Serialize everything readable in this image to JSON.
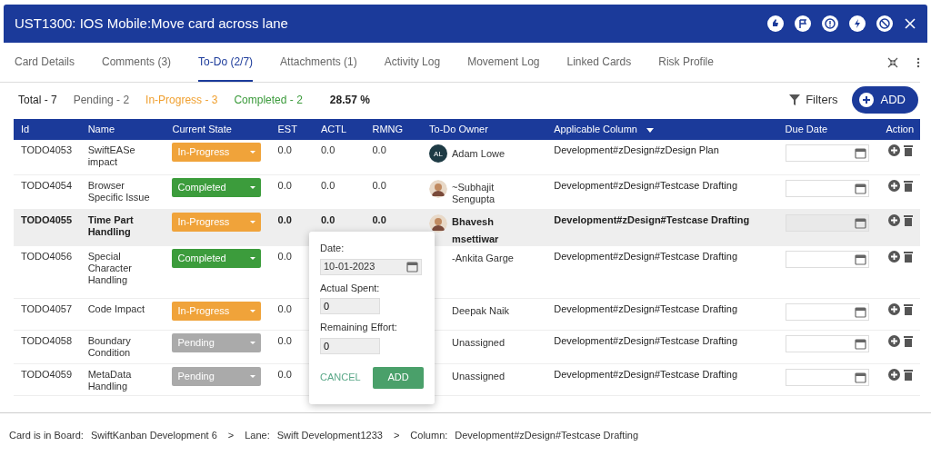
{
  "window": {
    "title": "UST1300:  IOS Mobile:Move card across lane"
  },
  "header_icons": [
    {
      "kind": "thumbs"
    },
    {
      "kind": "flag"
    },
    {
      "kind": "alert"
    },
    {
      "kind": "bolt"
    },
    {
      "kind": "block"
    }
  ],
  "tabs": [
    {
      "label": "Card Details",
      "selected": false
    },
    {
      "label": "Comments (3)",
      "selected": false
    },
    {
      "label": "To-Do (2/7)",
      "selected": true
    },
    {
      "label": "Attachments (1)",
      "selected": false
    },
    {
      "label": "Activity Log",
      "selected": false
    },
    {
      "label": "Movement Log",
      "selected": false
    },
    {
      "label": "Linked Cards",
      "selected": false
    },
    {
      "label": "Risk Profile",
      "selected": false
    }
  ],
  "summary": [
    {
      "text": "Total - 7",
      "color": "#222222"
    },
    {
      "text": "Pending - 2",
      "color": "#666666"
    },
    {
      "text": "In-Progress - 3",
      "color": "#f0a030"
    },
    {
      "text": "Completed - 2",
      "color": "#3a9a3a"
    },
    {
      "text": "28.57 %",
      "color": "#222222"
    }
  ],
  "filters_label": "Filters",
  "add_label": "ADD",
  "table": {
    "columns": [
      "Id",
      "Name",
      "Current State",
      "EST",
      "ACTL",
      "RMNG",
      "To-Do Owner",
      "Applicable Column",
      "Due Date",
      "Action"
    ],
    "rows": [
      {
        "id": "TODO4053",
        "name": "SwiftEASe impact",
        "state": {
          "label": "In-Progress",
          "kind": "progress"
        },
        "est": "0.0",
        "actl": "0.0",
        "rmng": "0.0",
        "owner": {
          "avatar": {
            "kind": "initials",
            "initials": "AL"
          },
          "lines": [
            "Adam Lowe"
          ]
        },
        "column": "Development#zDesign#zDesign Plan",
        "selected": false
      },
      {
        "id": "TODO4054",
        "name": "Browser Specific Issue",
        "state": {
          "label": "Completed",
          "kind": "done"
        },
        "est": "0.0",
        "actl": "0.0",
        "rmng": "0.0",
        "owner": {
          "avatar": {
            "kind": "photo"
          },
          "lines": [
            "~Subhajit Sengupta"
          ]
        },
        "column": "Development#zDesign#Testcase Drafting",
        "selected": false
      },
      {
        "id": "TODO4055",
        "name": "Time Part Handling",
        "state": {
          "label": "In-Progress",
          "kind": "progress"
        },
        "est": "0.0",
        "actl": "0.0",
        "rmng": "0.0",
        "owner": {
          "avatar": {
            "kind": "photo"
          },
          "lines": [
            "Bhavesh",
            "msettiwar"
          ]
        },
        "column": "Development#zDesign#Testcase Drafting",
        "selected": true
      },
      {
        "id": "TODO4056",
        "name": "Special Character Handling",
        "state": {
          "label": "Completed",
          "kind": "done"
        },
        "est": "0.0",
        "owner": {
          "lines": [
            "-Ankita Garge"
          ]
        },
        "column": "Development#zDesign#Testcase Drafting",
        "selected": false
      },
      {
        "id": "TODO4057",
        "name": "Code Impact",
        "state": {
          "label": "In-Progress",
          "kind": "progress"
        },
        "est": "0.0",
        "owner": {
          "lines": [
            "Deepak Naik"
          ]
        },
        "column": "Development#zDesign#Testcase Drafting",
        "selected": false
      },
      {
        "id": "TODO4058",
        "name": "Boundary Condition",
        "state": {
          "label": "Pending",
          "kind": "pending"
        },
        "est": "0.0",
        "owner": {
          "lines": [
            "Unassigned"
          ]
        },
        "column": "Development#zDesign#Testcase Drafting",
        "selected": false
      },
      {
        "id": "TODO4059",
        "name": "MetaData Handling",
        "state": {
          "label": "Pending",
          "kind": "pending"
        },
        "est": "0.0",
        "owner": {
          "lines": [
            "Unassigned"
          ]
        },
        "column": "Development#zDesign#Testcase Drafting",
        "selected": false
      }
    ]
  },
  "popover": {
    "date_label": "Date:",
    "date_value": "10-01-2023",
    "spent_label": "Actual Spent:",
    "spent_value": "0",
    "remaining_label": "Remaining Effort:",
    "remaining_value": "0",
    "cancel": "CANCEL",
    "add": "ADD"
  },
  "footer": [
    {
      "label": "Card is in Board:",
      "value": "SwiftKanban Development 6"
    },
    {
      "label": "Lane:",
      "value": "Swift Development1233"
    },
    {
      "label": "Column:",
      "value": "Development#zDesign#Testcase Drafting"
    }
  ],
  "footer_separator": ">"
}
